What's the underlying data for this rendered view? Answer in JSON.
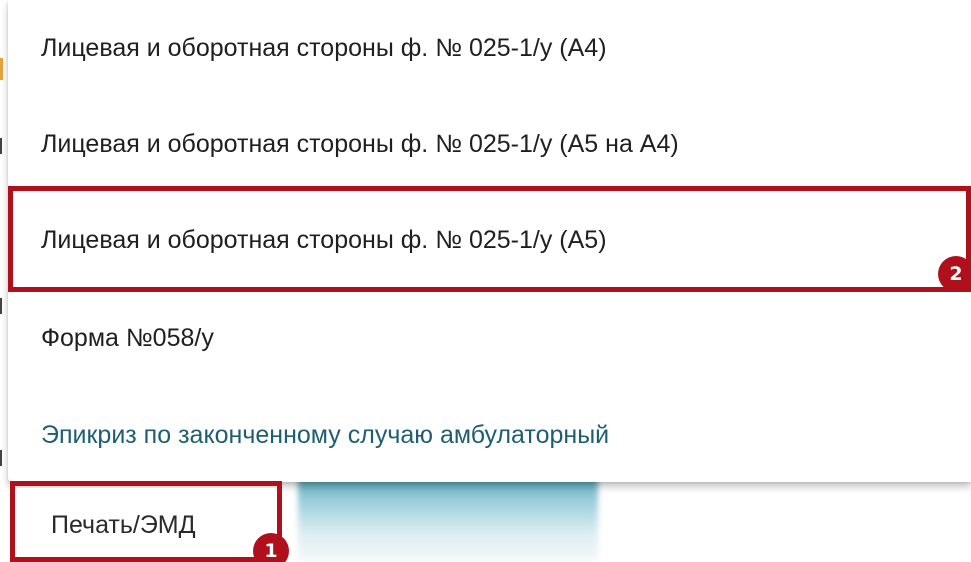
{
  "print_menu": {
    "items": [
      {
        "label": "Лицевая и оборотная стороны ф. № 025-1/у (А4)"
      },
      {
        "label": "Лицевая и оборотная стороны ф. № 025-1/у (А5 на А4)"
      },
      {
        "label": "Лицевая и оборотная стороны ф. № 025-1/у (А5)"
      },
      {
        "label": "Форма №058/у"
      },
      {
        "label": "Эпикриз по законченному случаю амбулаторный"
      }
    ]
  },
  "toolbar": {
    "print_label": "Печать/ЭМД"
  },
  "annotations": {
    "step_1": "1",
    "step_2": "2"
  },
  "colors": {
    "highlight": "#b0101c",
    "link_text": "#1e5e72",
    "text": "#1f1f1f"
  }
}
